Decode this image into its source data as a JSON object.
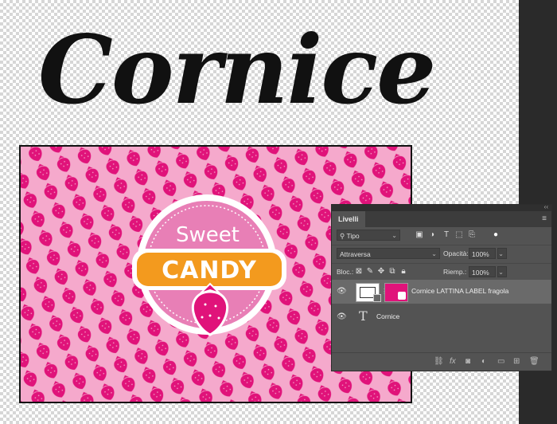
{
  "canvas": {
    "title": "Cornice"
  },
  "artwork": {
    "sweet": "Sweet",
    "candy": "CANDY"
  },
  "panel": {
    "tab": "Livelli",
    "filter_kind": "Tipo",
    "blend_mode": "Attraversa",
    "opacity_label": "Opacità:",
    "opacity_value": "100%",
    "lock_label": "Bloc.:",
    "fill_label": "Riemp.:",
    "fill_value": "100%",
    "layers": [
      {
        "name": "Cornice LATTINA LABEL fragola",
        "type": "smart-object",
        "visible": true,
        "selected": true
      },
      {
        "name": "Cornice",
        "type": "text",
        "visible": true,
        "selected": false
      }
    ]
  },
  "colors": {
    "pattern_bg": "#f5a9cc",
    "strawberry": "#e0137a",
    "badge_pink": "#e87fb6",
    "candy_orange": "#f39a1e",
    "panel_bg": "#535353"
  }
}
